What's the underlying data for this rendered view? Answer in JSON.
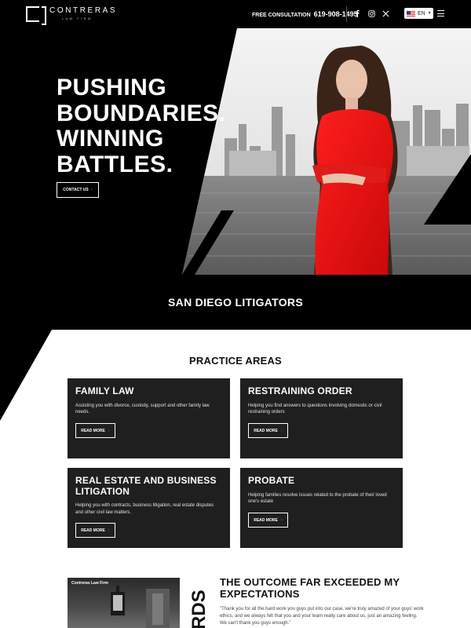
{
  "header": {
    "logo_name": "CONTRERAS",
    "logo_sub": "LAW FIRM",
    "consult_label": "FREE CONSULTATION",
    "phone": "619-908-1495",
    "social_icons": [
      "facebook-icon",
      "instagram-icon",
      "x-icon"
    ],
    "language": "EN"
  },
  "hero": {
    "title_lines": [
      "PUSHING",
      "BOUNDARIES.",
      "WINNING",
      "BATTLES."
    ],
    "cta": "CONTACT US",
    "tagline": "SAN DIEGO LITIGATORS"
  },
  "practice": {
    "heading": "PRACTICE AREAS",
    "cards": [
      {
        "title": "FAMILY LAW",
        "desc": "Assisting you with divorce, custody, support and other family law needs.",
        "button": "READ MORE"
      },
      {
        "title": "RESTRAINING ORDER",
        "desc": "Helping you find answers to questions involving domestic or civil restraining orders",
        "button": "READ MORE"
      },
      {
        "title": "REAL ESTATE AND BUSINESS LITIGATION",
        "desc": "Helping you with contracts, business litigation, real estate disputes and other civil law matters.",
        "button": "READ MORE"
      },
      {
        "title": "PROBATE",
        "desc": "Helping families resolve issues related to the probate of their loved one's estate",
        "button": "READ MORE"
      }
    ]
  },
  "testimonial": {
    "image_label": "Contreras Law Firm",
    "vertical_text": "RDS",
    "title": "THE OUTCOME FAR EXCEEDED MY EXPECTATIONS",
    "quote": "\"Thank you for all the hard work you guys put into our case, we're truly amazed of your guys' work ethics, and we always felt that you and your team really care about us, just an amazing feeling. We can't thank you guys enough.\""
  },
  "colors": {
    "accent_red": "#d42020",
    "dark_card": "#1f1f1f",
    "background_black": "#000000"
  }
}
